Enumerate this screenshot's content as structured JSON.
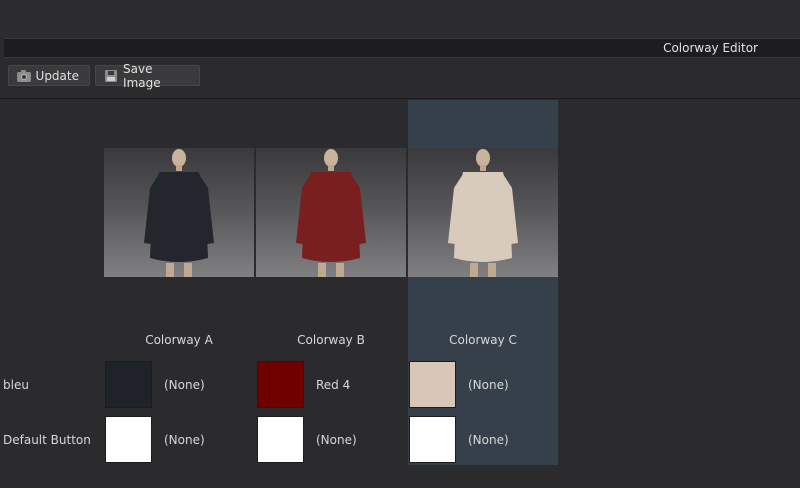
{
  "window": {
    "title": "Colorway Editor"
  },
  "toolbar": {
    "update_label": "Update",
    "save_image_label": "Save Image"
  },
  "colorways": [
    {
      "name": "Colorway A",
      "garment_color": "#23262d",
      "selected": false
    },
    {
      "name": "Colorway B",
      "garment_color": "#7a1f1f",
      "selected": false
    },
    {
      "name": "Colorway C",
      "garment_color": "#d8cbbb",
      "selected": true
    }
  ],
  "rows": [
    {
      "label": "bleu",
      "cells": [
        {
          "color": "#1f2229",
          "text": "(None)"
        },
        {
          "color": "#6f0000",
          "text": "Red 4"
        },
        {
          "color": "#dac6b7",
          "text": "(None)"
        }
      ]
    },
    {
      "label": "Default Button",
      "cells": [
        {
          "color": "#ffffff",
          "text": "(None)"
        },
        {
          "color": "#ffffff",
          "text": "(None)"
        },
        {
          "color": "#ffffff",
          "text": "(None)"
        }
      ]
    }
  ],
  "icons": {
    "update": "camera-icon",
    "save_image": "save-icon"
  }
}
